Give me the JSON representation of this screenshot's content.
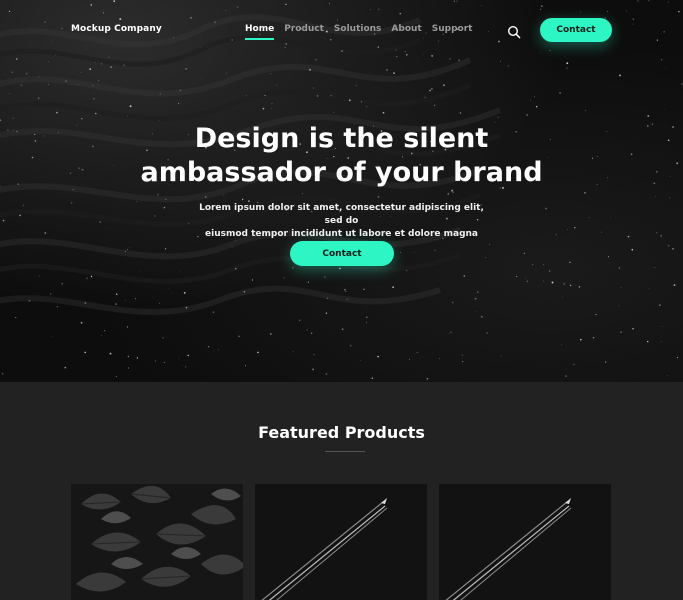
{
  "brand": {
    "name": "Mockup Company"
  },
  "nav": {
    "items": [
      {
        "label": "Home",
        "active": true
      },
      {
        "label": "Product",
        "active": false
      },
      {
        "label": "Solutions",
        "active": false
      },
      {
        "label": "About",
        "active": false
      },
      {
        "label": "Support",
        "active": false
      }
    ],
    "search_icon": "search-icon",
    "contact_label": "Contact"
  },
  "hero": {
    "title_line1": "Design is the silent",
    "title_line2": "ambassador of your brand",
    "subtitle_line1": "Lorem ipsum dolor sit amet, consectetur adipiscing elit, sed do",
    "subtitle_line2": "eiusmod tempor incididunt ut labore et dolore magna aliqua.",
    "cta_label": "Contact"
  },
  "featured": {
    "title": "Featured Products",
    "cards": [
      {
        "image": "dark-leaves-photo"
      },
      {
        "image": "airplane-contrail-photo"
      },
      {
        "image": "airplane-contrail-photo"
      }
    ]
  },
  "colors": {
    "accent": "#2ef5c4",
    "hero_bg": "#0d0d0d",
    "section_bg": "#222222"
  }
}
